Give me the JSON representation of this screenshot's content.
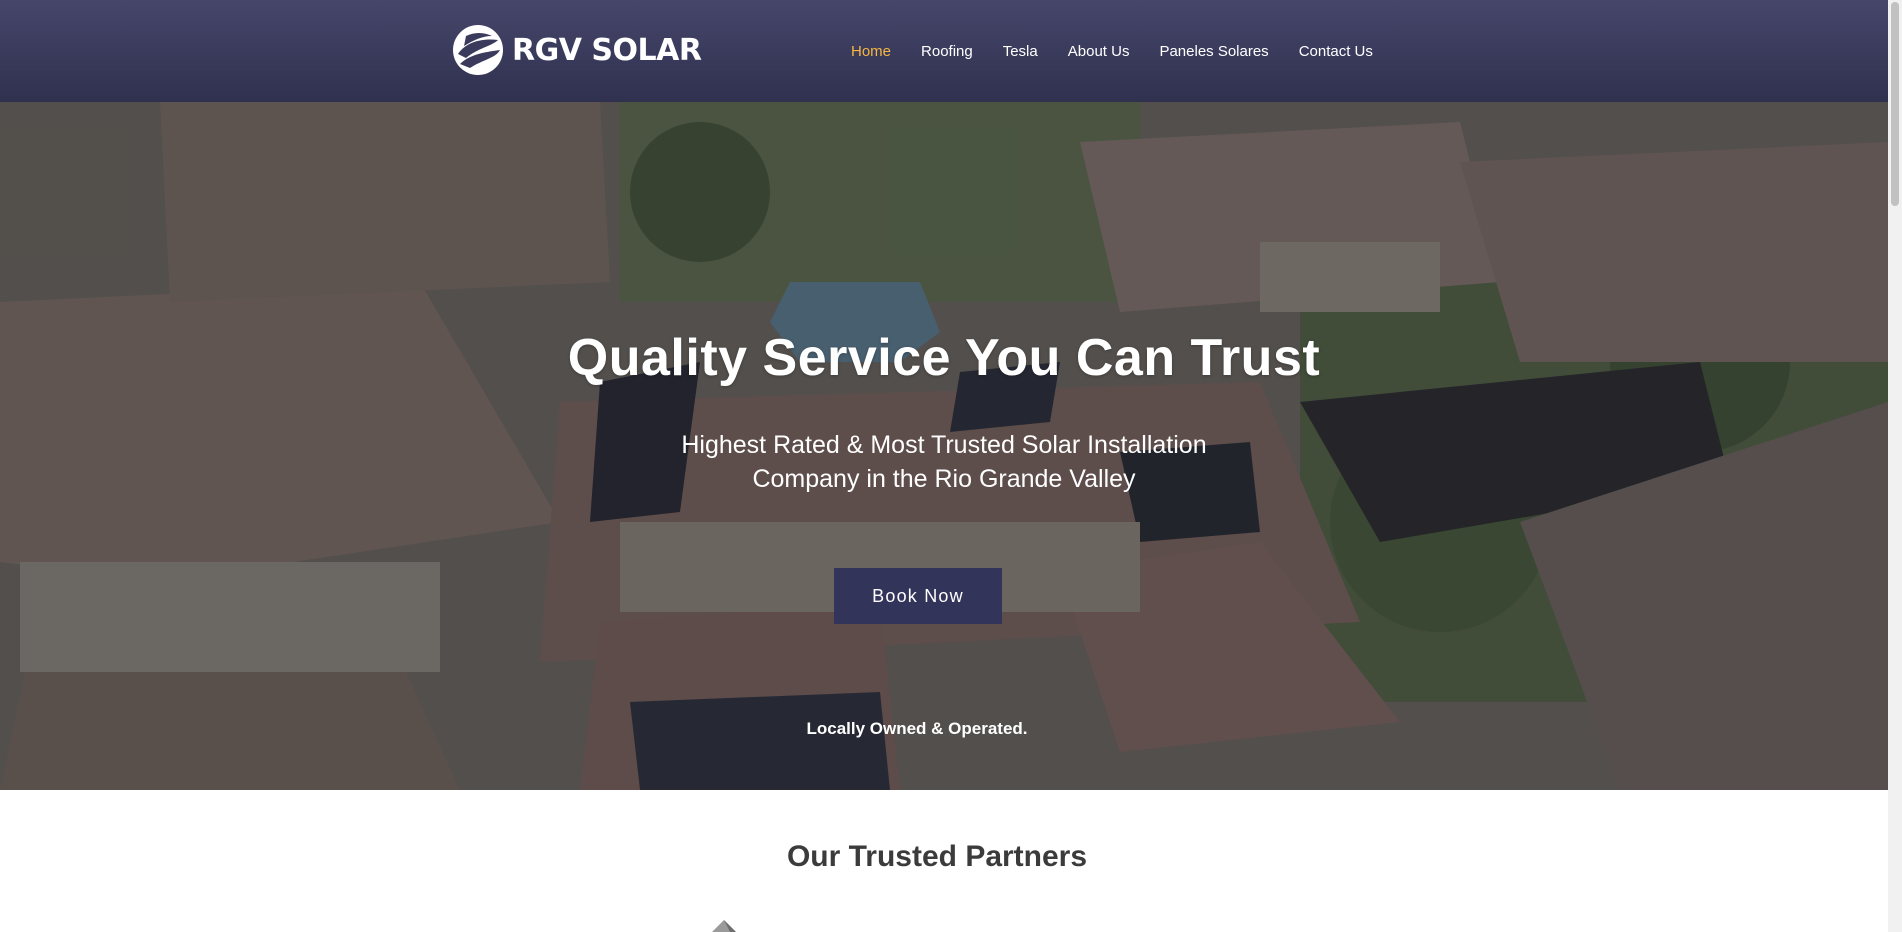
{
  "brand": {
    "name": "RGV SOLAR",
    "logo_icon": "globe-swirl-icon"
  },
  "nav": {
    "items": [
      {
        "label": "Home",
        "active": true
      },
      {
        "label": "Roofing",
        "active": false
      },
      {
        "label": "Tesla",
        "active": false
      },
      {
        "label": "About Us",
        "active": false
      },
      {
        "label": "Paneles Solares",
        "active": false
      },
      {
        "label": "Contact Us",
        "active": false
      }
    ]
  },
  "hero": {
    "title": "Quality Service You Can Trust",
    "subtitle_line1": "Highest Rated & Most Trusted Solar Installation",
    "subtitle_line2": "Company in the Rio Grande Valley",
    "cta_label": "Book Now",
    "tagline": "Locally Owned & Operated."
  },
  "partners": {
    "title": "Our Trusted Partners"
  },
  "colors": {
    "header": "#3a3b5c",
    "nav_active": "#f5b642",
    "button": "#33345a",
    "heading_dark": "#3b3b3b"
  }
}
